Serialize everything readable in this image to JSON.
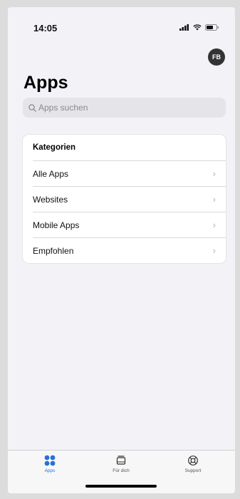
{
  "status_bar": {
    "time": "14:05",
    "icons": [
      "signal-icon",
      "wifi-icon",
      "battery-icon"
    ]
  },
  "header": {
    "avatar_initials": "FB",
    "title": "Apps"
  },
  "search": {
    "placeholder": "Apps suchen",
    "value": ""
  },
  "categories": {
    "header": "Kategorien",
    "items": [
      {
        "label": "Alle Apps"
      },
      {
        "label": "Websites"
      },
      {
        "label": "Mobile Apps"
      },
      {
        "label": "Empfohlen"
      }
    ]
  },
  "tab_bar": {
    "tabs": [
      {
        "label": "Apps",
        "icon": "apps-grid-icon",
        "active": true
      },
      {
        "label": "Für dich",
        "icon": "for-you-icon",
        "active": false
      },
      {
        "label": "Support",
        "icon": "support-lifebuoy-icon",
        "active": false
      }
    ]
  },
  "colors": {
    "accent": "#2b6fd6",
    "background": "#f2f2f7"
  }
}
